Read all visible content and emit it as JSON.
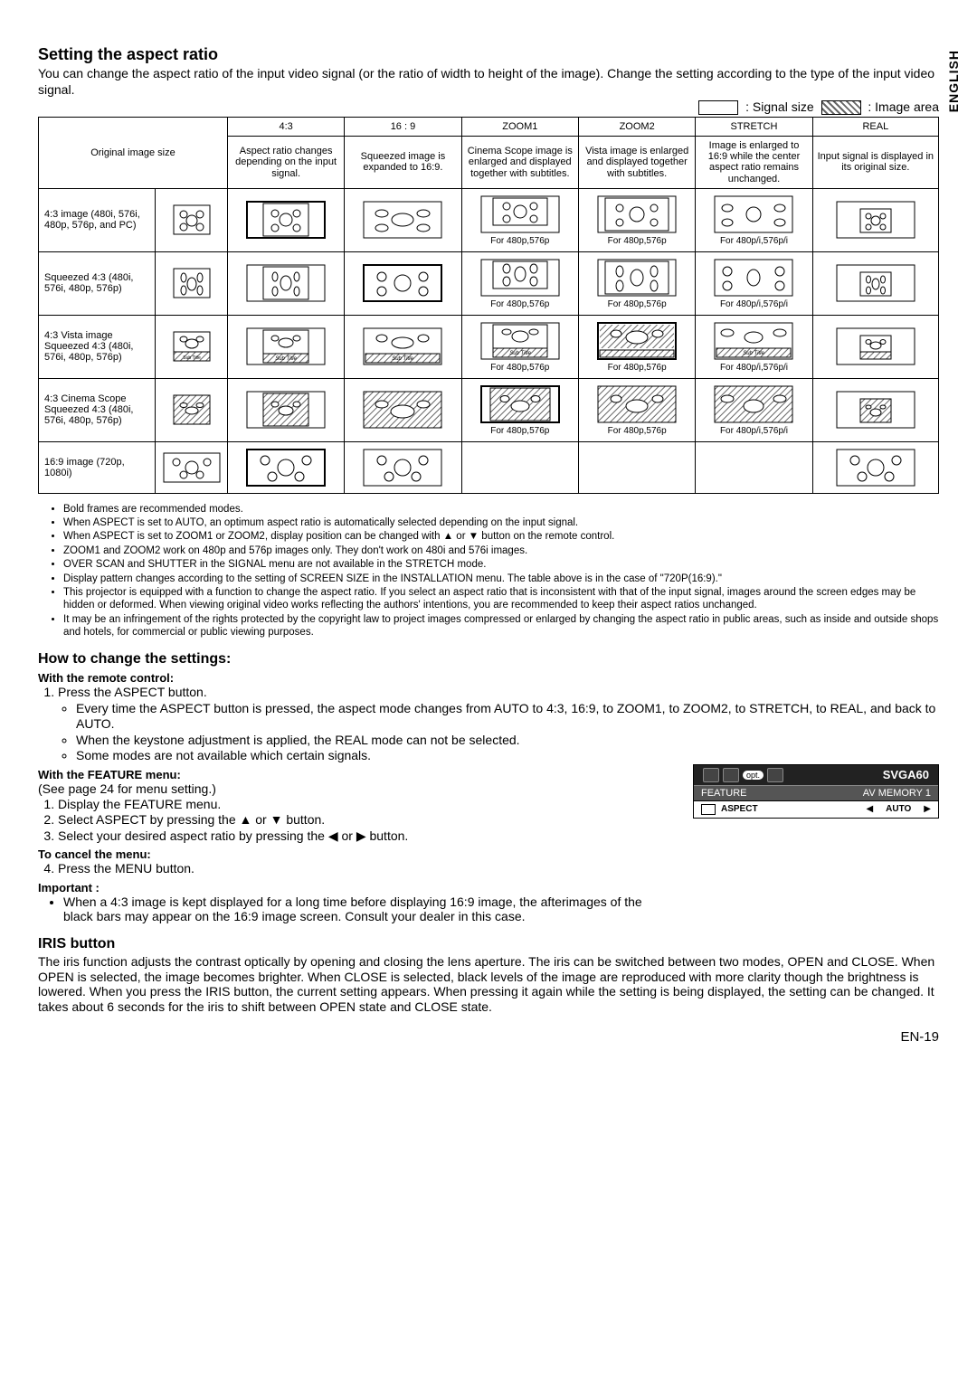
{
  "lang_side": "ENGLISH",
  "h_aspect": "Setting the aspect ratio",
  "intro": "You can change the aspect ratio of the input video signal (or the ratio of width to height of the image). Change the setting according to the type of the input video signal.",
  "legend_signal": ": Signal size",
  "legend_image": ": Image area",
  "table": {
    "hdr_original": "Original image size",
    "cols": [
      "4:3",
      "16 : 9",
      "ZOOM1",
      "ZOOM2",
      "STRETCH",
      "REAL"
    ],
    "descs": [
      "Aspect ratio changes depending on the input signal.",
      "Squeezed image is expanded to 16:9.",
      "Cinema Scope image is enlarged and displayed together with subtitles.",
      "Vista image is enlarged and displayed together with subtitles.",
      "Image is enlarged to 16:9 while the center aspect ratio remains unchanged.",
      "Input signal is displayed in its original size."
    ],
    "row_labels": [
      "4:3 image (480i, 576i, 480p, 576p, and PC)",
      "Squeezed 4:3 (480i, 576i, 480p, 576p)",
      "4:3 Vista image Squeezed 4:3 (480i, 576i, 480p, 576p)",
      "4:3 Cinema Scope Squeezed 4:3 (480i, 576i, 480p, 576p)",
      "16:9 image (720p, 1080i)"
    ],
    "caption_a": "For 480p,576p",
    "caption_b": "For 480p/i,576p/i",
    "subtitle": "Sub Title"
  },
  "bullets": [
    "Bold frames are recommended modes.",
    "When ASPECT is set to AUTO, an optimum aspect ratio is automatically selected depending on the input signal.",
    "When ASPECT is set to ZOOM1 or ZOOM2, display position can be changed with ▲ or ▼ button on the remote control.",
    "ZOOM1 and ZOOM2 work on 480p and 576p images only. They don't work on 480i and 576i images.",
    "OVER SCAN and SHUTTER in the SIGNAL menu are not available in the STRETCH mode.",
    "Display pattern changes according to the setting of SCREEN SIZE in the INSTALLATION menu. The table above is in the case of \"720P(16:9).\"",
    "This projector is equipped with a function to change the aspect ratio. If you select an aspect ratio that is inconsistent with that of the input signal, images around the screen edges may be hidden or deformed. When viewing original video works reflecting the authors' intentions, you are recommended to keep their aspect ratios unchanged.",
    "It may be an infringement of the rights protected by the copyright law to project images compressed or enlarged by changing the aspect ratio in public areas, such as inside and outside shops and hotels, for commercial or public viewing purposes."
  ],
  "h_change": "How to change the settings:",
  "remote_hdr": "With the remote control:",
  "remote_step1": "Press the ASPECT button.",
  "remote_sub": [
    "Every time the ASPECT button is pressed, the aspect mode changes from AUTO to 4:3, 16:9, to ZOOM1, to ZOOM2, to STRETCH, to REAL, and back to AUTO.",
    "When the keystone adjustment is applied, the REAL mode can not be selected.",
    "Some modes are not available which certain signals."
  ],
  "feat_hdr": "With the FEATURE menu:",
  "feat_note": "(See page 24 for menu setting.)",
  "feat_steps": [
    "Display the FEATURE menu.",
    "Select ASPECT by pressing the ▲ or ▼ button.",
    "Select your desired aspect ratio by pressing the ◀ or ▶ button."
  ],
  "cancel_hdr": "To cancel the menu:",
  "cancel_step": "Press the MENU button.",
  "important_hdr": "Important :",
  "important_bullet": "When a 4:3 image is kept displayed for a long time before displaying 16:9 image, the afterimages of the black bars may appear on the 16:9 image screen. Consult your dealer in this case.",
  "h_iris": "IRIS button",
  "iris_p": "The iris function adjusts the contrast optically by opening and closing the lens aperture. The iris can be switched between two modes, OPEN and CLOSE. When OPEN is selected, the image becomes brighter. When CLOSE is selected, black levels of the image are reproduced with more clarity though the brightness is lowered. When you press the IRIS button, the current setting appears. When pressing it again while the setting is being displayed, the setting can be changed. It takes about 6 seconds for the iris to shift between OPEN state and CLOSE state.",
  "menu": {
    "opt": "opt.",
    "signal": "SVGA60",
    "feature": "FEATURE",
    "avmem": "AV MEMORY 1",
    "aspect": "ASPECT",
    "auto": "AUTO"
  },
  "page": "EN-19"
}
